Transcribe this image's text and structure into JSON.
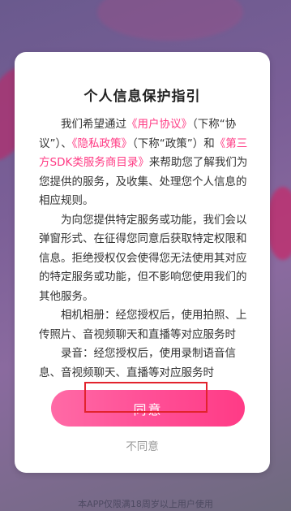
{
  "dialog": {
    "title": "个人信息保护指引",
    "p1_prefix": "我们希望通过",
    "user_agreement_link": "《用户协议》",
    "p1_mid1": "（下称“协议”）、",
    "privacy_policy_link": "《隐私政策》",
    "p1_mid2": "（下称“政策”）和",
    "sdk_list_link": "《第三方SDK类服务商目录》",
    "p1_suffix": "来帮助您了解我们为您提供的服务，及收集、处理您个人信息的相应规则。",
    "p2": "为向您提供特定服务或功能，我们会以弹窗形式、在征得您同意后获取特定权限和信息。拒绝授权仅会使得您无法使用其对应的特定服务或功能，但不影响您使用我们的其他服务。",
    "p3": "相机相册：经您授权后，使用拍照、上传照片、音视频聊天和直播等对应服务时",
    "p4": "录音：经您授权后，使用录制语音信息、音视频聊天、直播等对应服务时",
    "agree_label": "同意",
    "decline_label": "不同意"
  },
  "footer_text": "本APP仅限满18周岁以上用户使用",
  "colors": {
    "accent": "#ff3b84",
    "highlight_box": "#e2232d"
  }
}
